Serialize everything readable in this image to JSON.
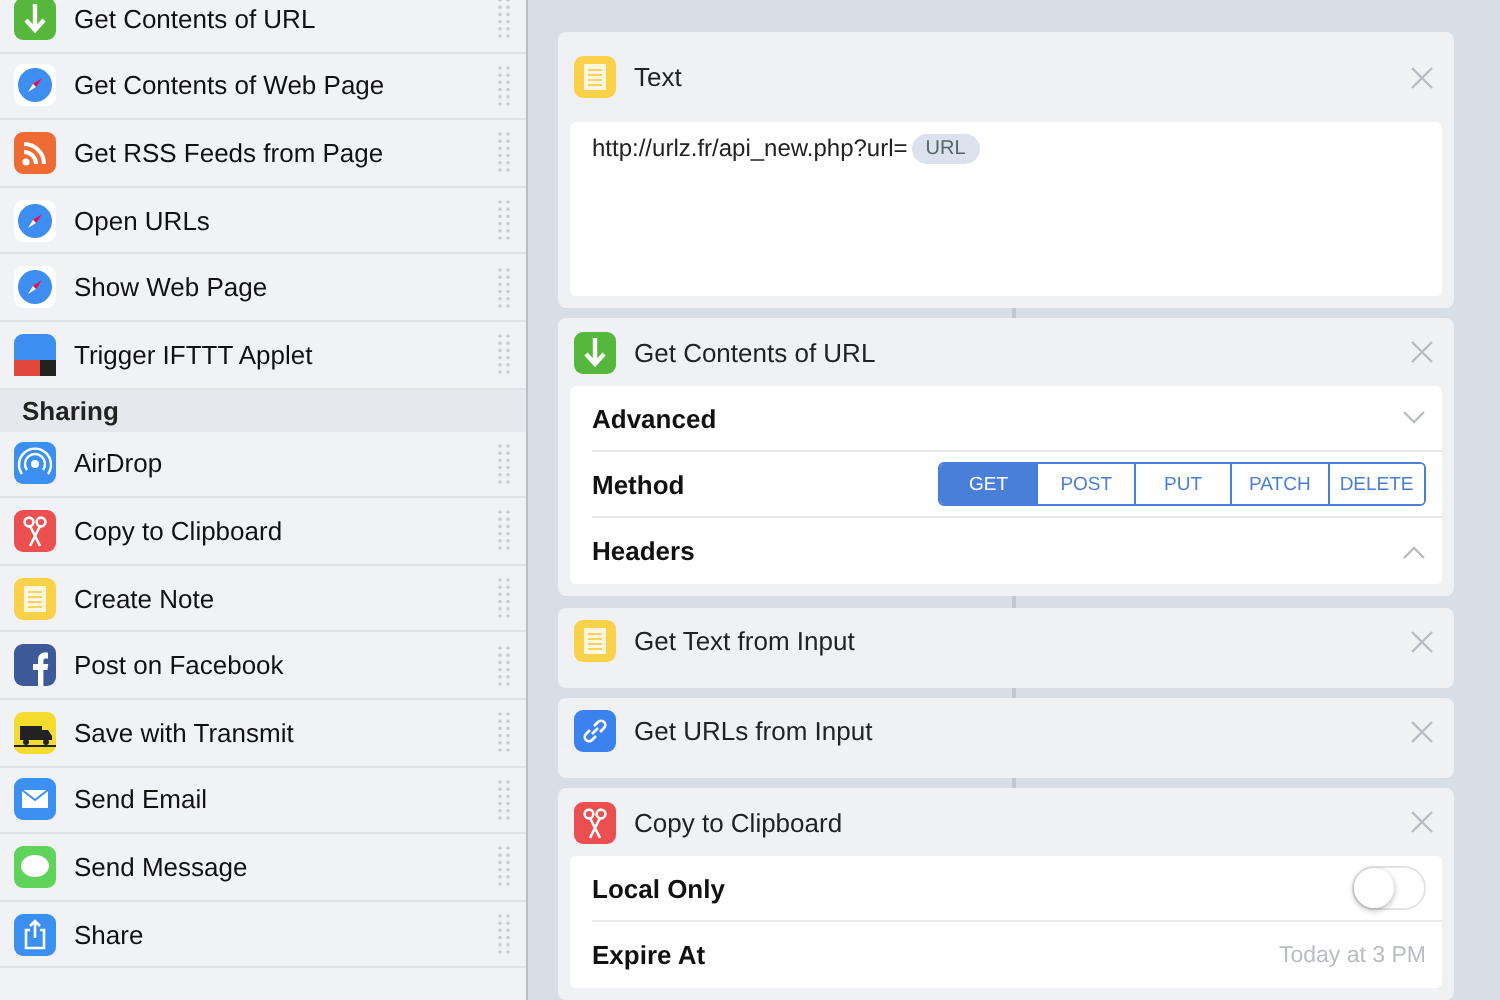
{
  "sidebar": {
    "items": [
      {
        "kind": "download",
        "label": "Get Contents of URL"
      },
      {
        "kind": "compass",
        "label": "Get Contents of Web Page"
      },
      {
        "kind": "rss",
        "label": "Get RSS Feeds from Page"
      },
      {
        "kind": "compass",
        "label": "Open URLs"
      },
      {
        "kind": "compass",
        "label": "Show Web Page"
      },
      {
        "kind": "applet",
        "label": "Trigger IFTTT Applet"
      },
      {
        "kind": "header",
        "label": "Sharing"
      },
      {
        "kind": "airdrop",
        "label": "AirDrop"
      },
      {
        "kind": "scissors",
        "label": "Copy to Clipboard"
      },
      {
        "kind": "note",
        "label": "Create Note"
      },
      {
        "kind": "facebook",
        "label": "Post on Facebook"
      },
      {
        "kind": "truck",
        "label": "Save with Transmit"
      },
      {
        "kind": "mail",
        "label": "Send Email"
      },
      {
        "kind": "message",
        "label": "Send Message"
      },
      {
        "kind": "share",
        "label": "Share"
      }
    ]
  },
  "actions": [
    {
      "kind": "text",
      "title": "Text",
      "text": "http://urlz.fr/api_new.php?url=",
      "token": "URL"
    },
    {
      "kind": "params",
      "title": "Get Contents of URL",
      "rows": [
        {
          "kind": "disclosure",
          "label": "Advanced",
          "expanded": false
        },
        {
          "kind": "segmented",
          "label": "Method",
          "options": [
            {
              "label": "GET",
              "selected": true
            },
            {
              "label": "POST",
              "selected": false
            },
            {
              "label": "PUT",
              "selected": false
            },
            {
              "label": "PATCH",
              "selected": false
            },
            {
              "label": "DELETE",
              "selected": false
            }
          ]
        },
        {
          "kind": "disclosure",
          "label": "Headers",
          "expanded": true
        }
      ]
    },
    {
      "kind": "plain",
      "title": "Get Text from Input"
    },
    {
      "kind": "plain",
      "title": "Get URLs from Input"
    },
    {
      "kind": "params",
      "title": "Copy to Clipboard",
      "rows": [
        {
          "kind": "toggle",
          "label": "Local Only",
          "on": false
        },
        {
          "kind": "value",
          "label": "Expire At",
          "value": "Today at 3 PM"
        }
      ]
    }
  ]
}
